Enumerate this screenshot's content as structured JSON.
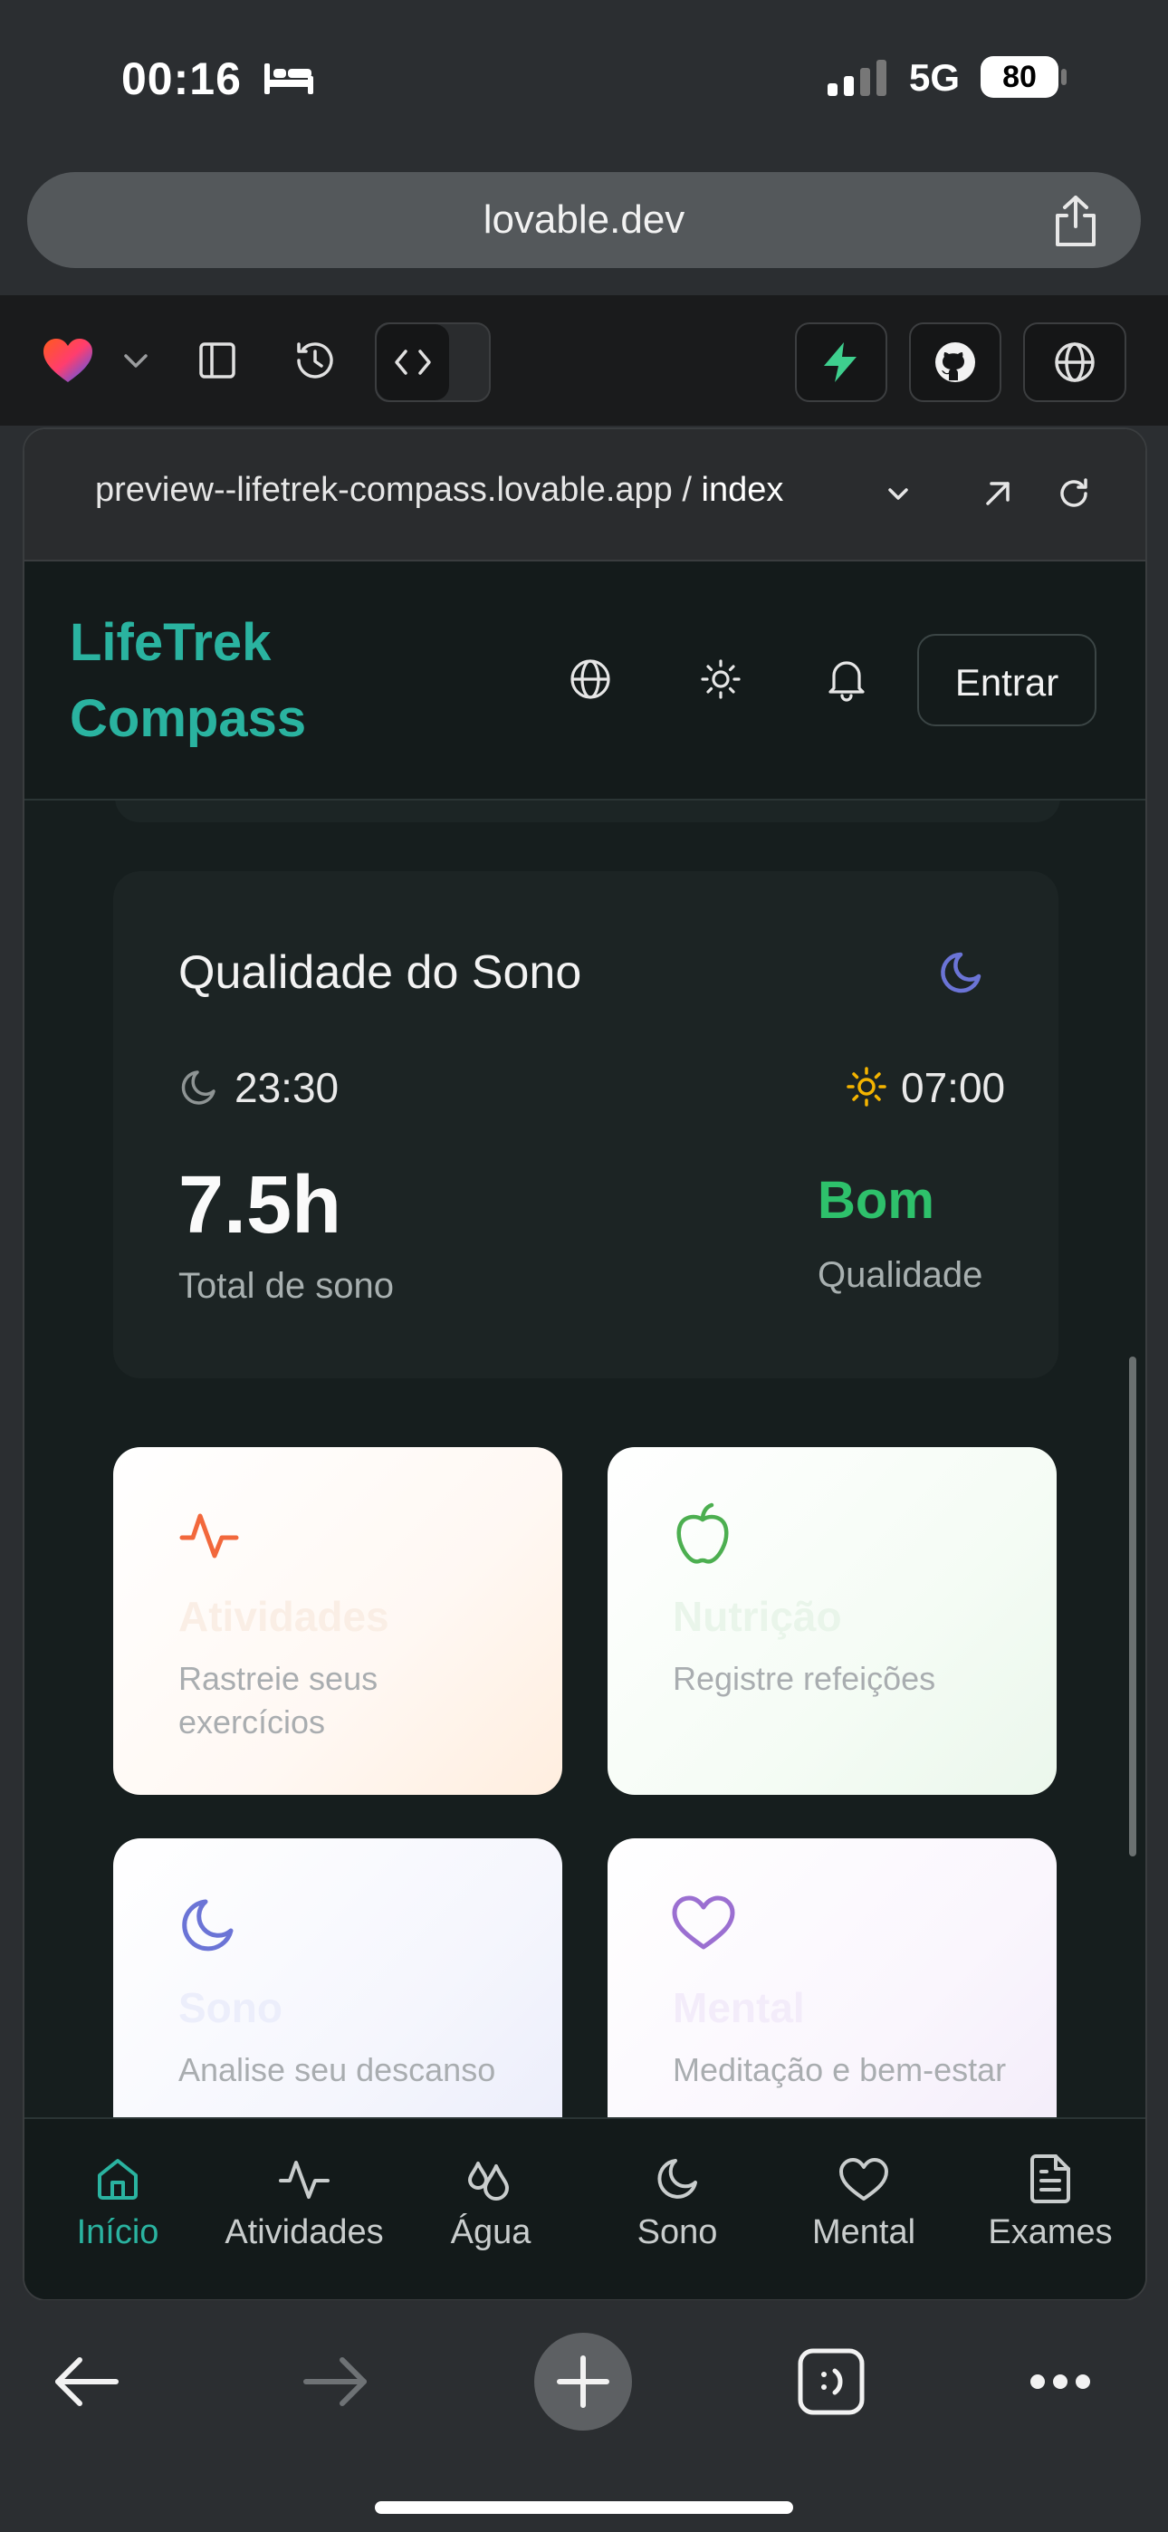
{
  "status_bar": {
    "time": "00:16",
    "network": "5G",
    "battery": "80"
  },
  "browser": {
    "url": "lovable.dev"
  },
  "preview": {
    "url_prefix": "preview--lifetrek-compass.lovable.app / ",
    "route": "index"
  },
  "app": {
    "brand_line1": "LifeTrek",
    "brand_line2": "Compass",
    "login_label": "Entrar"
  },
  "sleep_card": {
    "title": "Qualidade do Sono",
    "bedtime": "23:30",
    "wake_time": "07:00",
    "total": "7.5h",
    "total_label": "Total de sono",
    "quality": "Bom",
    "quality_label": "Qualidade"
  },
  "features": [
    {
      "title": "Atividades",
      "desc": "Rastreie seus exercícios"
    },
    {
      "title": "Nutrição",
      "desc": "Registre refeições"
    },
    {
      "title": "Sono",
      "desc": "Analise seu descanso"
    },
    {
      "title": "Mental",
      "desc": "Meditação e bem-estar"
    }
  ],
  "bottom_nav": [
    {
      "label": "Início"
    },
    {
      "label": "Atividades"
    },
    {
      "label": "Água"
    },
    {
      "label": "Sono"
    },
    {
      "label": "Mental"
    },
    {
      "label": "Exames"
    }
  ],
  "colors": {
    "brand": "#2ab3a0",
    "quality_good": "#2ec16b",
    "moon": "#6b74d6",
    "sun": "#f4b400",
    "activity": "#f2683c",
    "nutrition": "#4caf50",
    "mental": "#9b6fd1"
  }
}
